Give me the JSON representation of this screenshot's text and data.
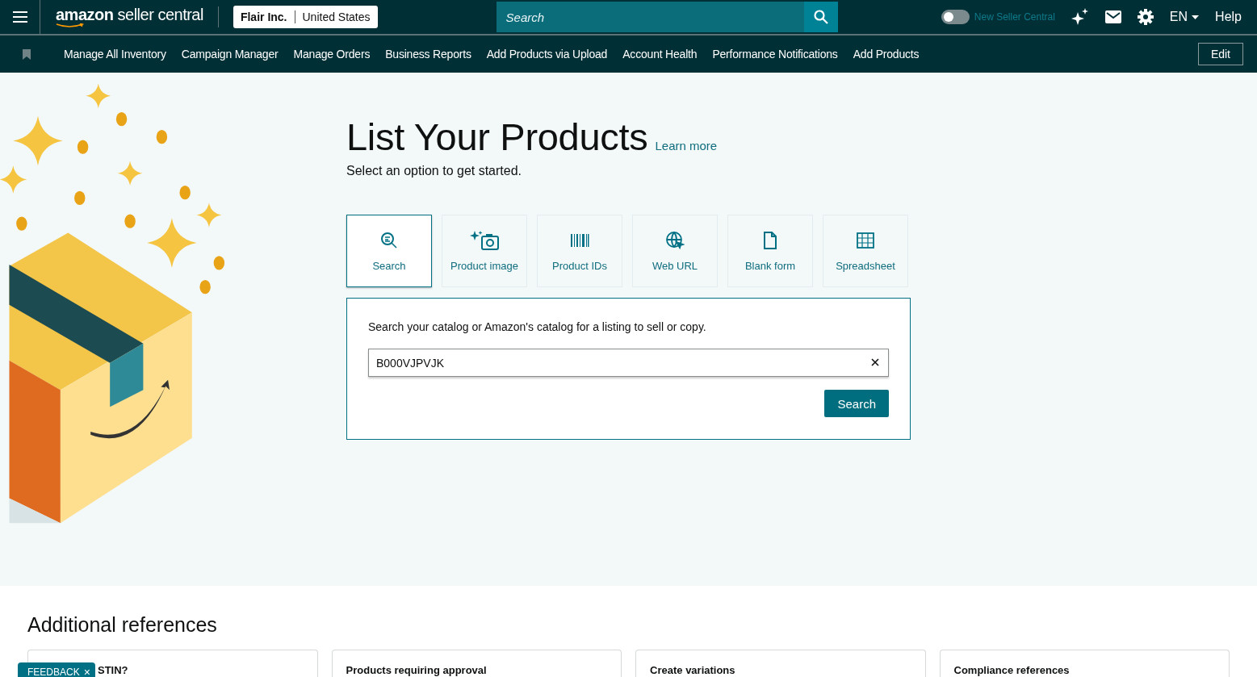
{
  "top_bar": {
    "logo": {
      "brand": "amazon",
      "product": "seller central"
    },
    "account": {
      "name": "Flair Inc.",
      "region": "United States"
    },
    "search": {
      "placeholder": "Search"
    },
    "new_ui_toggle": {
      "on": false,
      "label": "New Seller Central"
    },
    "language": "EN",
    "help": "Help"
  },
  "nav": {
    "items": [
      "Manage All Inventory",
      "Campaign Manager",
      "Manage Orders",
      "Business Reports",
      "Add Products via Upload",
      "Account Health",
      "Performance Notifications",
      "Add Products"
    ],
    "edit": "Edit"
  },
  "page": {
    "title": "List Your Products",
    "learn_more": "Learn more",
    "subtitle": "Select an option to get started."
  },
  "options": [
    {
      "kind": "search",
      "label": "Search",
      "selected": true
    },
    {
      "kind": "image",
      "label": "Product image",
      "selected": false
    },
    {
      "kind": "barcode",
      "label": "Product IDs",
      "selected": false
    },
    {
      "kind": "web",
      "label": "Web URL",
      "selected": false
    },
    {
      "kind": "form",
      "label": "Blank form",
      "selected": false
    },
    {
      "kind": "sheet",
      "label": "Spreadsheet",
      "selected": false
    }
  ],
  "search_panel": {
    "description": "Search your catalog or Amazon's catalog for a listing to sell or copy.",
    "value": "B000VJPVJK",
    "button": "Search"
  },
  "additional_references": {
    "title": "Additional references",
    "cards": [
      "STIN?",
      "Products requiring approval",
      "Create variations",
      "Compliance references"
    ]
  },
  "feedback": {
    "label": "FEEDBACK",
    "close": "×"
  }
}
